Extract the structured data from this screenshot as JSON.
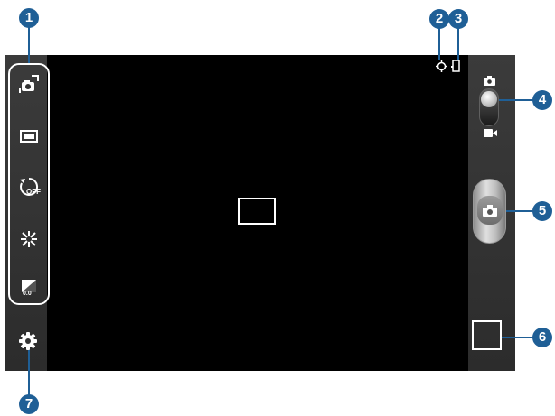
{
  "callouts": {
    "c1": "1",
    "c2": "2",
    "c3": "3",
    "c4": "4",
    "c5": "5",
    "c6": "6",
    "c7": "7"
  },
  "quick_settings": {
    "items": [
      {
        "icon": "switch-camera-icon"
      },
      {
        "icon": "photo-size-icon"
      },
      {
        "icon": "timer-off-icon",
        "label": "OFF"
      },
      {
        "icon": "effects-icon"
      },
      {
        "icon": "exposure-icon",
        "label": "0.0"
      }
    ]
  },
  "settings": {
    "icon": "gear-icon"
  },
  "status": {
    "gps_icon": "gps-icon",
    "storage_icon": "storage-icon"
  },
  "mode_switch": {
    "top_icon": "camera-mode-icon",
    "bottom_icon": "camcorder-mode-icon",
    "selected": "camera"
  },
  "shutter": {
    "icon": "camera-icon"
  },
  "colors": {
    "callout": "#1f5f96",
    "panel": "#333333",
    "viewfinder": "#000000"
  }
}
